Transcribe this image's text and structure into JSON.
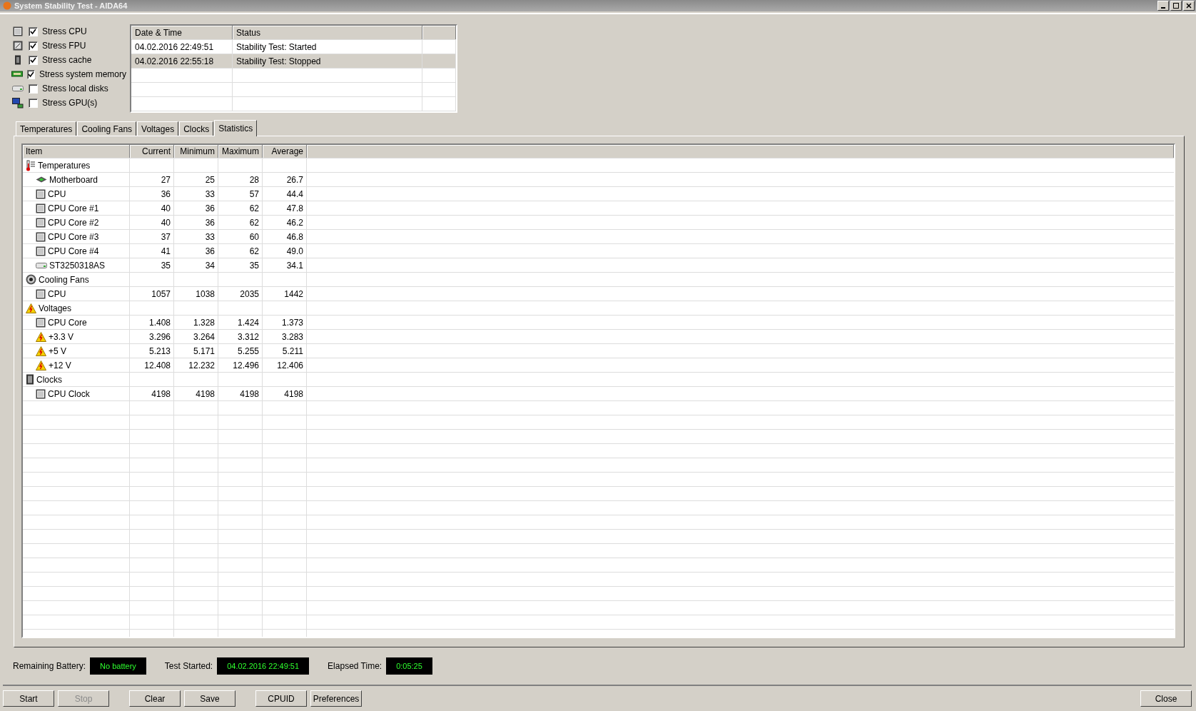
{
  "window": {
    "title": "System Stability Test - AIDA64"
  },
  "stress_options": [
    {
      "label": "Stress CPU",
      "kind": "cpu",
      "checked": true
    },
    {
      "label": "Stress FPU",
      "kind": "fpu",
      "checked": true
    },
    {
      "label": "Stress cache",
      "kind": "cache",
      "checked": true
    },
    {
      "label": "Stress system memory",
      "kind": "memory",
      "checked": true
    },
    {
      "label": "Stress local disks",
      "kind": "disk",
      "checked": false
    },
    {
      "label": "Stress GPU(s)",
      "kind": "gpu",
      "checked": false
    }
  ],
  "log": {
    "columns": [
      "Date & Time",
      "Status"
    ],
    "rows": [
      {
        "date_time": "04.02.2016 22:49:51",
        "status": "Stability Test: Started",
        "selected": false
      },
      {
        "date_time": "04.02.2016 22:55:18",
        "status": "Stability Test: Stopped",
        "selected": true
      }
    ]
  },
  "tabs": [
    {
      "label": "Temperatures",
      "selected": false
    },
    {
      "label": "Cooling Fans",
      "selected": false
    },
    {
      "label": "Voltages",
      "selected": false
    },
    {
      "label": "Clocks",
      "selected": false
    },
    {
      "label": "Statistics",
      "selected": true
    }
  ],
  "statistics": {
    "columns": [
      "Item",
      "Current",
      "Minimum",
      "Maximum",
      "Average"
    ],
    "groups": [
      {
        "label": "Temperatures",
        "kind": "thermometer",
        "children": [
          {
            "label": "Motherboard",
            "kind": "motherboard",
            "values": [
              "27",
              "25",
              "28",
              "26.7"
            ]
          },
          {
            "label": "CPU",
            "kind": "cpu",
            "values": [
              "36",
              "33",
              "57",
              "44.4"
            ]
          },
          {
            "label": "CPU Core #1",
            "kind": "cpu",
            "values": [
              "40",
              "36",
              "62",
              "47.8"
            ]
          },
          {
            "label": "CPU Core #2",
            "kind": "cpu",
            "values": [
              "40",
              "36",
              "62",
              "46.2"
            ]
          },
          {
            "label": "CPU Core #3",
            "kind": "cpu",
            "values": [
              "37",
              "33",
              "60",
              "46.8"
            ]
          },
          {
            "label": "CPU Core #4",
            "kind": "cpu",
            "values": [
              "41",
              "36",
              "62",
              "49.0"
            ]
          },
          {
            "label": "ST3250318AS",
            "kind": "disk",
            "values": [
              "35",
              "34",
              "35",
              "34.1"
            ]
          }
        ]
      },
      {
        "label": "Cooling Fans",
        "kind": "fan",
        "children": [
          {
            "label": "CPU",
            "kind": "cpu",
            "values": [
              "1057",
              "1038",
              "2035",
              "1442"
            ]
          }
        ]
      },
      {
        "label": "Voltages",
        "kind": "warning",
        "children": [
          {
            "label": "CPU Core",
            "kind": "cpu",
            "values": [
              "1.408",
              "1.328",
              "1.424",
              "1.373"
            ]
          },
          {
            "label": "+3.3 V",
            "kind": "warning",
            "values": [
              "3.296",
              "3.264",
              "3.312",
              "3.283"
            ]
          },
          {
            "label": "+5 V",
            "kind": "warning",
            "values": [
              "5.213",
              "5.171",
              "5.255",
              "5.211"
            ]
          },
          {
            "label": "+12 V",
            "kind": "warning",
            "values": [
              "12.408",
              "12.232",
              "12.496",
              "12.406"
            ]
          }
        ]
      },
      {
        "label": "Clocks",
        "kind": "clock",
        "children": [
          {
            "label": "CPU Clock",
            "kind": "cpu",
            "values": [
              "4198",
              "4198",
              "4198",
              "4198"
            ]
          }
        ]
      }
    ]
  },
  "status": [
    {
      "label": "Remaining Battery:",
      "value": "No battery"
    },
    {
      "label": "Test Started:",
      "value": "04.02.2016 22:49:51"
    },
    {
      "label": "Elapsed Time:",
      "value": "0:05:25"
    }
  ],
  "button_groups": [
    [
      {
        "label": "Start",
        "disabled": false
      },
      {
        "label": "Stop",
        "disabled": true
      }
    ],
    [
      {
        "label": "Clear",
        "disabled": false
      },
      {
        "label": "Save",
        "disabled": false
      }
    ],
    [
      {
        "label": "CPUID",
        "disabled": false
      },
      {
        "label": "Preferences",
        "disabled": false
      }
    ]
  ],
  "close_button": {
    "label": "Close",
    "disabled": false
  }
}
